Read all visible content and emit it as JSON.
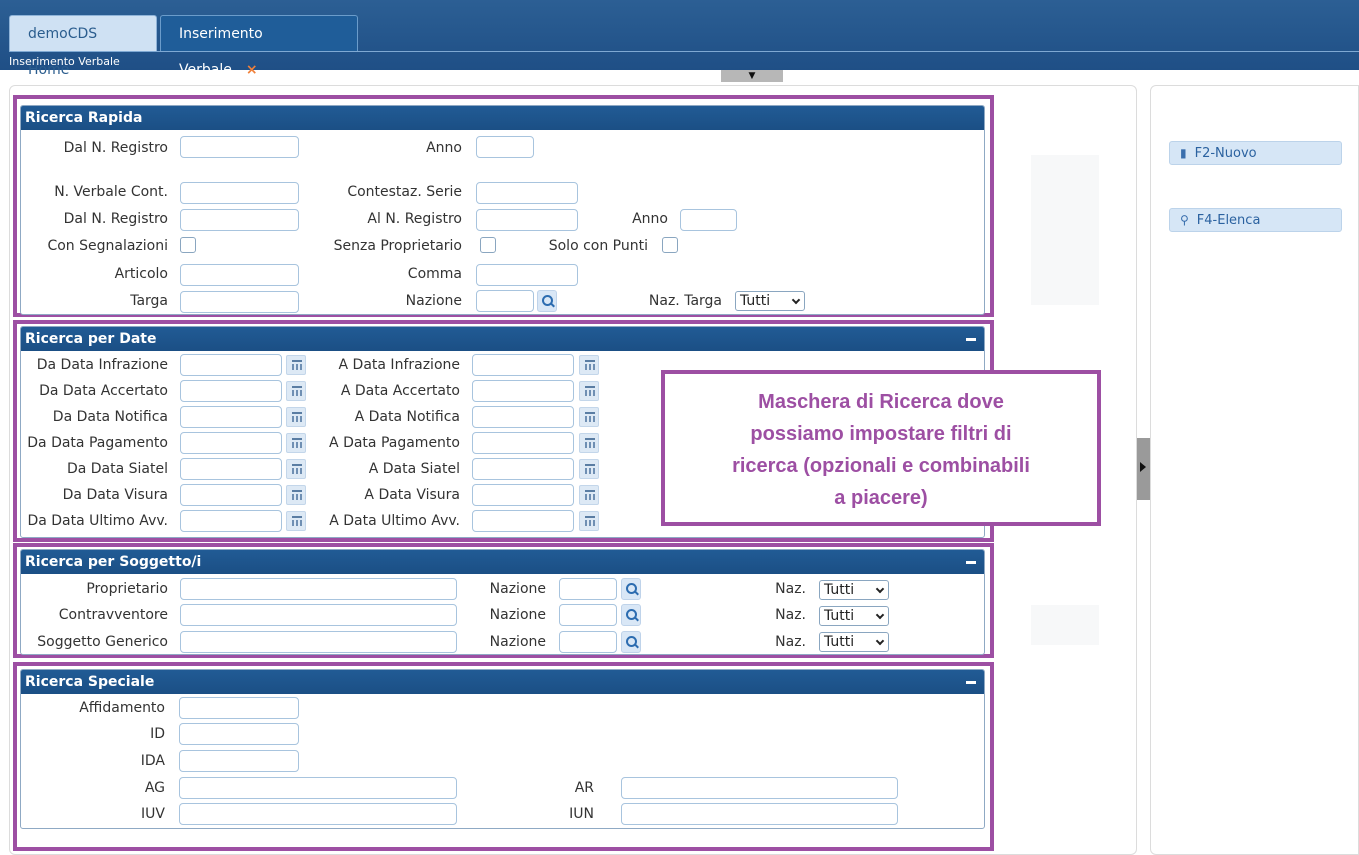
{
  "tabs": {
    "home": "demoCDS Home",
    "active": "Inserimento Verbale",
    "close": "×"
  },
  "breadcrumb": "Inserimento Verbale",
  "toggle_glyph": "▼",
  "side_buttons": {
    "nuovo": "F2-Nuovo",
    "elenca": "F4-Elenca"
  },
  "ricerca_rapida": {
    "title": "Ricerca Rapida",
    "dal_n_registro": "Dal N. Registro",
    "anno": "Anno",
    "n_verbale_cont": "N. Verbale Cont.",
    "contestaz_serie": "Contestaz. Serie",
    "dal_n_registro_2": "Dal N. Registro",
    "al_n_registro": "Al N. Registro",
    "anno_2": "Anno",
    "con_segnalazioni": "Con Segnalazioni",
    "senza_proprietario": "Senza Proprietario",
    "solo_con_punti": "Solo con Punti",
    "articolo": "Articolo",
    "comma": "Comma",
    "targa": "Targa",
    "nazione": "Nazione",
    "naz_targa": "Naz. Targa",
    "naz_targa_value": "Tutti"
  },
  "ricerca_date": {
    "title": "Ricerca per Date",
    "rows": [
      {
        "from": "Da Data Infrazione",
        "to": "A Data Infrazione"
      },
      {
        "from": "Da Data Accertato",
        "to": "A Data Accertato"
      },
      {
        "from": "Da Data Notifica",
        "to": "A Data Notifica"
      },
      {
        "from": "Da Data Pagamento",
        "to": "A Data Pagamento"
      },
      {
        "from": "Da Data Siatel",
        "to": "A Data Siatel"
      },
      {
        "from": "Da Data Visura",
        "to": "A Data Visura"
      },
      {
        "from": "Da Data Ultimo Avv.",
        "to": "A Data Ultimo Avv."
      }
    ]
  },
  "ricerca_soggetto": {
    "title": "Ricerca per Soggetto/i",
    "rows": [
      {
        "label": "Proprietario",
        "nazione": "Nazione",
        "naz": "Naz.",
        "value": "Tutti"
      },
      {
        "label": "Contravventore",
        "nazione": "Nazione",
        "naz": "Naz.",
        "value": "Tutti"
      },
      {
        "label": "Soggetto Generico",
        "nazione": "Nazione",
        "naz": "Naz.",
        "value": "Tutti"
      }
    ]
  },
  "ricerca_speciale": {
    "title": "Ricerca Speciale",
    "affidamento": "Affidamento",
    "id": "ID",
    "ida": "IDA",
    "ag": "AG",
    "ar": "AR",
    "iuv": "IUV",
    "iun": "IUN"
  },
  "callout": {
    "line1": "Maschera di Ricerca dove",
    "line2": "possiamo impostare filtri di",
    "line3": "ricerca (opzionali e combinabili",
    "line4": "a piacere)"
  },
  "colors": {
    "header_blue": "#1f5d99",
    "annotation_purple": "#9d4fa3",
    "close_orange": "#f0813b"
  }
}
